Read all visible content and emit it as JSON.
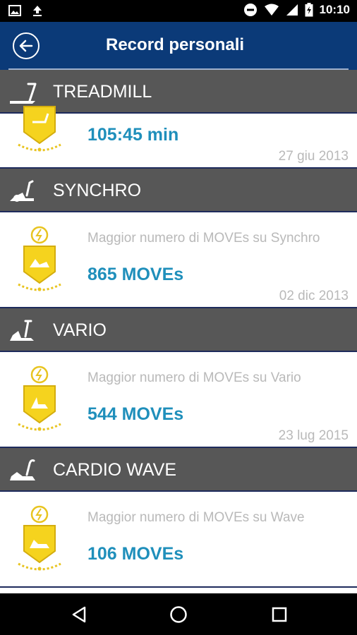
{
  "status": {
    "time": "10:10"
  },
  "header": {
    "title": "Record personali"
  },
  "sections": [
    {
      "name": "TREADMILL",
      "icon": "treadmill-icon",
      "description": "",
      "value": "105:45 min",
      "date": "27 giu 2013"
    },
    {
      "name": "SYNCHRO",
      "icon": "synchro-icon",
      "description": "Maggior numero di MOVEs su Synchro",
      "value": "865 MOVEs",
      "date": "02 dic 2013"
    },
    {
      "name": "VARIO",
      "icon": "vario-icon",
      "description": "Maggior numero di MOVEs su Vario",
      "value": "544 MOVEs",
      "date": "23 lug 2015"
    },
    {
      "name": "CARDIO WAVE",
      "icon": "cardio-wave-icon",
      "description": "Maggior numero di MOVEs su Wave",
      "value": "106 MOVEs",
      "date": ""
    }
  ],
  "colors": {
    "app_bar": "#0b3a78",
    "section_header": "#575757",
    "value": "#1f8fbb",
    "badge": "#f5d31e"
  }
}
